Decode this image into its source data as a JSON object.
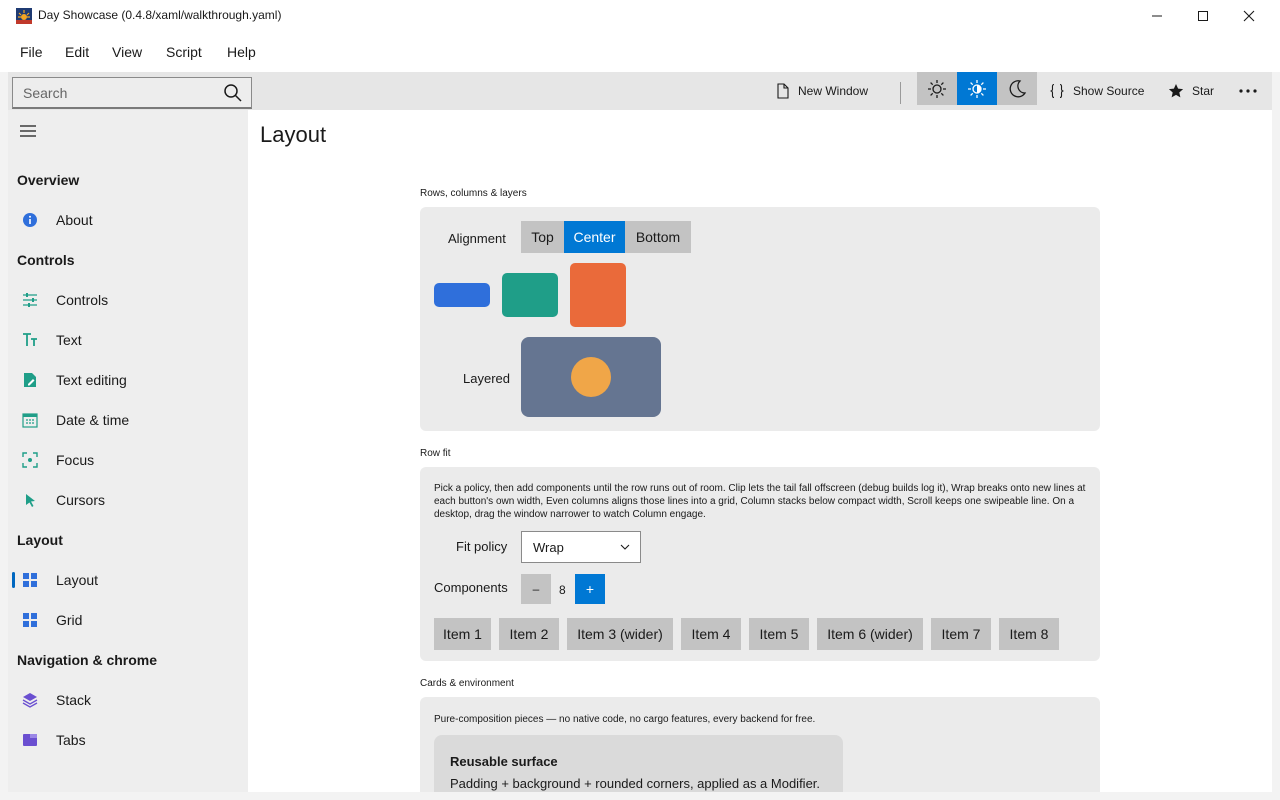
{
  "window": {
    "title": "Day Showcase (0.4.8/xaml/walkthrough.yaml)"
  },
  "menu": [
    "File",
    "Edit",
    "View",
    "Script",
    "Help"
  ],
  "toolbar": {
    "search_placeholder": "Search",
    "new_window": "New Window",
    "show_source": "Show Source",
    "star": "Star",
    "active_theme": "contrast"
  },
  "sidebar": {
    "sections": [
      {
        "title": "Overview",
        "items": [
          {
            "label": "About",
            "icon": "info-icon"
          }
        ]
      },
      {
        "title": "Controls",
        "items": [
          {
            "label": "Controls",
            "icon": "sliders-icon"
          },
          {
            "label": "Text",
            "icon": "text-size-icon"
          },
          {
            "label": "Text editing",
            "icon": "pen-icon"
          },
          {
            "label": "Date & time",
            "icon": "calendar-icon"
          },
          {
            "label": "Focus",
            "icon": "focus-icon"
          },
          {
            "label": "Cursors",
            "icon": "cursor-icon"
          }
        ]
      },
      {
        "title": "Layout",
        "items": [
          {
            "label": "Layout",
            "icon": "layout-grid-icon",
            "active": true
          },
          {
            "label": "Grid",
            "icon": "grid-icon"
          }
        ]
      },
      {
        "title": "Navigation & chrome",
        "items": [
          {
            "label": "Stack",
            "icon": "stack-icon"
          },
          {
            "label": "Tabs",
            "icon": "tabs-icon"
          }
        ]
      }
    ]
  },
  "page": {
    "title": "Layout",
    "rows": {
      "heading": "Rows, columns & layers",
      "alignment_label": "Alignment",
      "alignment_options": [
        "Top",
        "Center",
        "Bottom"
      ],
      "alignment_selected": "Center",
      "layered_label": "Layered",
      "colors": {
        "blue": "#2f6fdb",
        "teal": "#1f9e88",
        "orange": "#ea6a3a",
        "slate": "#657591",
        "amber": "#f0a648"
      }
    },
    "row_fit": {
      "heading": "Row fit",
      "description": "Pick a policy, then add components until the row runs out of room. Clip lets the tail fall offscreen (debug builds log it), Wrap breaks onto new lines at each button's own width, Even columns aligns those lines into a grid, Column stacks below compact width, Scroll keeps one swipeable line. On a desktop, drag the window narrower to watch Column engage.",
      "fit_policy_label": "Fit policy",
      "fit_policy_value": "Wrap",
      "components_label": "Components",
      "minus": "–",
      "plus": "+",
      "count": "8",
      "items": [
        "Item 1",
        "Item 2",
        "Item 3 (wider)",
        "Item 4",
        "Item 5",
        "Item 6 (wider)",
        "Item 7",
        "Item 8"
      ]
    },
    "cards": {
      "heading": "Cards & environment",
      "description": "Pure-composition pieces — no native code, no cargo features, every backend for free.",
      "surface_title": "Reusable surface",
      "surface_text": "Padding + background + rounded corners, applied as a Modifier."
    }
  }
}
